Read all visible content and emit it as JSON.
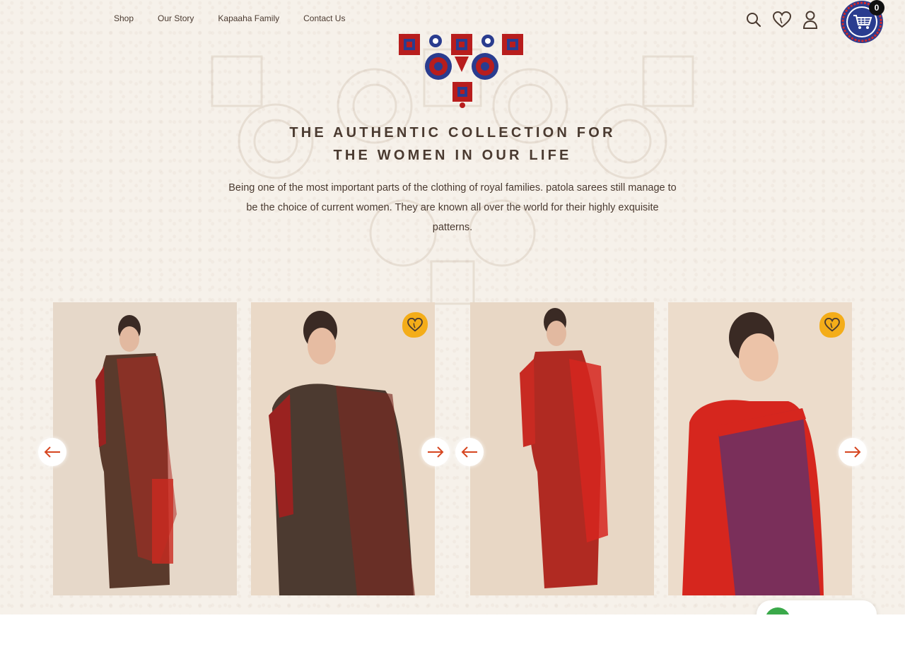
{
  "nav": {
    "links": [
      {
        "label": "Shop"
      },
      {
        "label": "Our Story"
      },
      {
        "label": "Kapaaha Family"
      },
      {
        "label": "Contact Us"
      }
    ],
    "icons": [
      "search-icon",
      "wishlist-heart-icon",
      "user-icon"
    ],
    "cart": {
      "icon": "cart-icon",
      "count": "0"
    }
  },
  "hero": {
    "heading_line1": "THE AUTHENTIC COLLECTION FOR",
    "heading_line2": "THE WOMEN IN OUR LIFE",
    "description": "Being one of the most important parts of the clothing of royal families. patola sarees still manage to be the choice of current women. They are known all over the world for their highly exquisite patterns."
  },
  "products": [
    {
      "image": "model-in-green-red-patola-saree",
      "wishlist_visible": false,
      "saree_color": "#5a3a2c"
    },
    {
      "image": "model-in-green-red-patola-saree-closeup",
      "wishlist_visible": true,
      "saree_color": "#4c3a30"
    },
    {
      "image": "model-in-red-patola-saree",
      "wishlist_visible": false,
      "saree_color": "#b02a22"
    },
    {
      "image": "model-in-purple-red-patola-saree",
      "wishlist_visible": true,
      "saree_color": "#7a2f5a"
    }
  ],
  "colors": {
    "accent": "#d6451f",
    "wishlist_badge": "#f4ad19",
    "text": "#4a3a30",
    "background": "#f6f1ea",
    "motif_red": "#b81d1d",
    "motif_blue": "#2a3c8f",
    "whatsapp_green": "#3aa94a"
  }
}
